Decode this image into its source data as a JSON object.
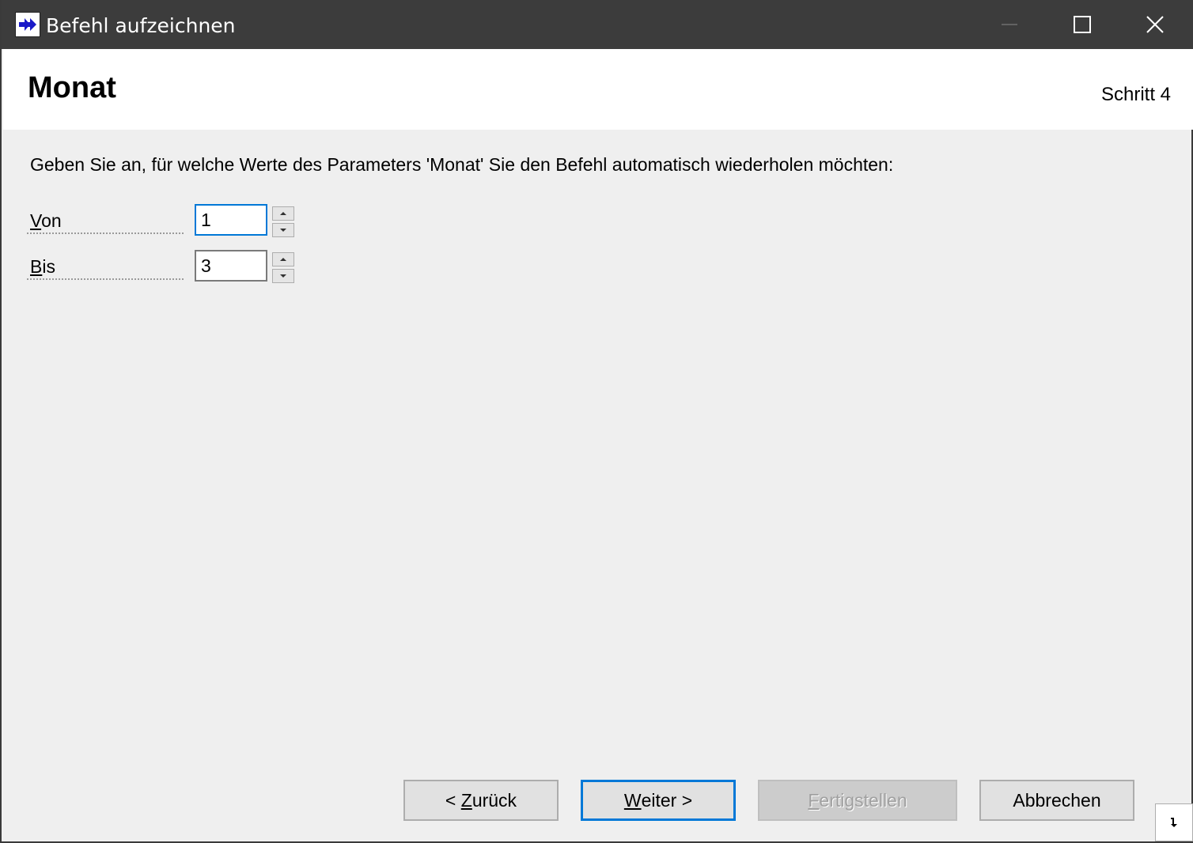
{
  "window": {
    "title": "Befehl aufzeichnen",
    "icon": "double-arrow-icon",
    "controls": [
      "minimize-icon",
      "maximize-icon",
      "close-icon"
    ]
  },
  "header": {
    "title": "Monat",
    "step": "Schritt 4"
  },
  "main": {
    "instruction": "Geben Sie an, für welche Werte des Parameters 'Monat' Sie den Befehl automatisch wiederholen möchten:",
    "fields": [
      {
        "label_access_key": "V",
        "label_rest": "on",
        "value": "1"
      },
      {
        "label_access_key": "B",
        "label_rest": "is",
        "value": "3"
      }
    ]
  },
  "footer": {
    "back_prefix": "< ",
    "back_key": "Z",
    "back_rest": "urück",
    "next_key": "W",
    "next_rest": "eiter >",
    "finish_key": "F",
    "finish_rest": "ertigstellen",
    "cancel": "Abbrechen"
  },
  "colors": {
    "titlebar": "#3c3c3c",
    "accent": "#0078d7",
    "background": "#efefef"
  }
}
